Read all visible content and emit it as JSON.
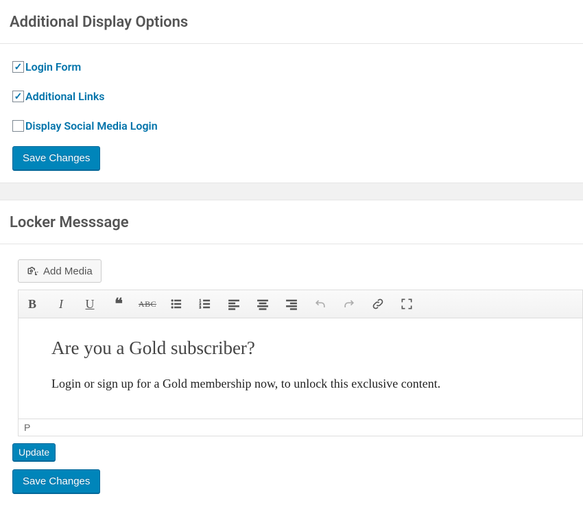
{
  "displayOptions": {
    "title": "Additional Display Options",
    "items": [
      {
        "label": "Login Form",
        "checked": true
      },
      {
        "label": "Additional Links",
        "checked": true
      },
      {
        "label": "Display Social Media Login",
        "checked": false
      }
    ],
    "saveLabel": "Save Changes"
  },
  "lockerMessage": {
    "title": "Locker Messsage",
    "addMediaLabel": "Add Media",
    "toolbar": {
      "bold": "B",
      "italic": "I",
      "underline": "U",
      "quote": "❝",
      "strike": "ABC"
    },
    "content": {
      "heading": "Are you a Gold subscriber?",
      "paragraph": "Login or sign up for a Gold membership now, to unlock this exclusive content."
    },
    "statusPath": "P",
    "updateLabel": "Update",
    "saveLabel": "Save Changes"
  }
}
